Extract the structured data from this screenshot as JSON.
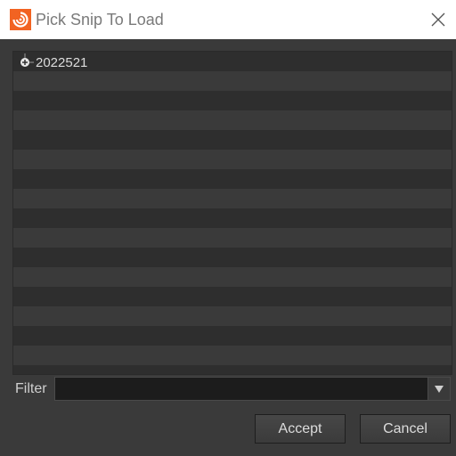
{
  "window": {
    "title": "Pick Snip To Load",
    "icon": "houdini-logo-icon",
    "accent_color": "#f26322"
  },
  "tree": {
    "items": [
      {
        "label": "2022521",
        "expanded": false,
        "expander_icon": "plus-expander-icon"
      }
    ]
  },
  "filter": {
    "label": "Filter",
    "value": ""
  },
  "buttons": {
    "accept": "Accept",
    "cancel": "Cancel"
  }
}
